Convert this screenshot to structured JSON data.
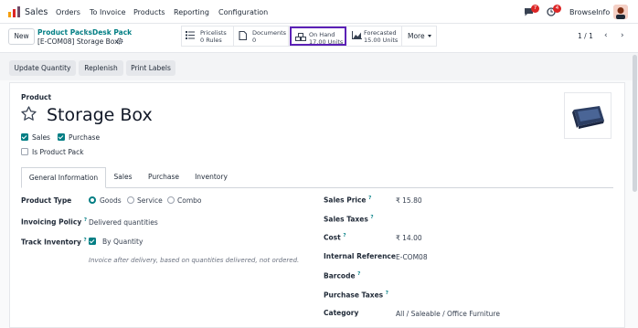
{
  "navbar": {
    "app_name": "Sales",
    "menu": [
      "Orders",
      "To Invoice",
      "Products",
      "Reporting",
      "Configuration"
    ],
    "messages_count": "7",
    "activities_count": "4",
    "company": "BrowseInfo"
  },
  "control": {
    "new_label": "New",
    "breadcrumb": [
      "Product Packs",
      "Desk Pack"
    ],
    "breadcrumb_sep": "/",
    "current_record": "[E-COM08] Storage Box",
    "pager": "1 / 1",
    "smart_buttons": [
      {
        "line1": "Pricelists",
        "line2": "0 Rules",
        "icon": "list-icon"
      },
      {
        "line1": "Documents",
        "line2": "0",
        "icon": "document-icon"
      },
      {
        "line1": "On Hand",
        "line2": "17.00 Units",
        "icon": "cubes-icon"
      },
      {
        "line1": "Forecasted",
        "line2": "15.00 Units",
        "icon": "chart-area-icon"
      }
    ],
    "more_label": "More"
  },
  "actions": [
    "Update Quantity",
    "Replenish",
    "Print Labels"
  ],
  "product": {
    "section_label": "Product",
    "name": "Storage Box",
    "checks": [
      {
        "label": "Sales",
        "checked": true
      },
      {
        "label": "Purchase",
        "checked": true
      },
      {
        "label": "Is Product Pack",
        "checked": false
      }
    ]
  },
  "tabs": [
    "General Information",
    "Sales",
    "Purchase",
    "Inventory"
  ],
  "left_fields": {
    "product_type_label": "Product Type",
    "product_type_options": [
      "Goods",
      "Service",
      "Combo"
    ],
    "invoicing_policy_label": "Invoicing Policy",
    "invoicing_policy_value": "Delivered quantities",
    "track_inventory_label": "Track Inventory",
    "track_inventory_value": "By Quantity",
    "note": "Invoice after delivery, based on quantities delivered, not ordered."
  },
  "right_fields": [
    {
      "label": "Sales Price",
      "value": "₹ 15.80",
      "help": true
    },
    {
      "label": "Sales Taxes",
      "value": "",
      "help": true
    },
    {
      "label": "Cost",
      "value": "₹ 14.00",
      "help": true
    },
    {
      "label": "Internal Reference",
      "value": "E-COM08",
      "help": false
    },
    {
      "label": "Barcode",
      "value": "",
      "help": true
    },
    {
      "label": "Purchase Taxes",
      "value": "",
      "help": true
    },
    {
      "label": "Category",
      "value": "All / Saleable / Office Furniture",
      "help": false
    }
  ],
  "help_mark": "?",
  "colors": {
    "accent": "#017e84",
    "brand": "#714b67",
    "highlight": "#5b21b6",
    "badge": "#dc2626"
  }
}
